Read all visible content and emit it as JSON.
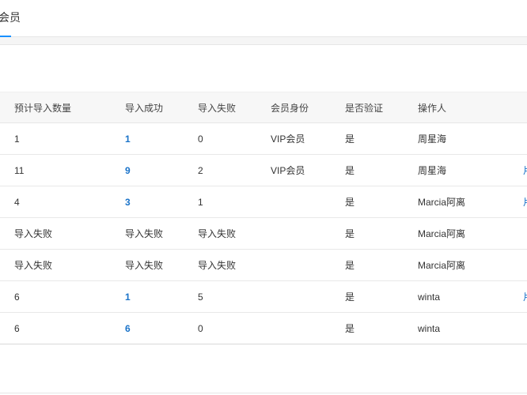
{
  "tab": {
    "label": "会员"
  },
  "table": {
    "headers": [
      "预计导入数量",
      "导入成功",
      "导入失败",
      "会员身份",
      "是否验证",
      "操作人"
    ],
    "rows": [
      {
        "expected": "1",
        "success": "1",
        "fail": "0",
        "identity": "VIP会员",
        "verified": "是",
        "operator": "周星海",
        "action": ""
      },
      {
        "expected": "11",
        "success": "9",
        "fail": "2",
        "identity": "VIP会员",
        "verified": "是",
        "operator": "周星海",
        "action": "片"
      },
      {
        "expected": "4",
        "success": "3",
        "fail": "1",
        "identity": "",
        "verified": "是",
        "operator": "Marcia阿离",
        "action": "片"
      },
      {
        "expected": "导入失败",
        "success": "导入失败",
        "fail": "导入失败",
        "identity": "",
        "verified": "是",
        "operator": "Marcia阿离",
        "action": ""
      },
      {
        "expected": "导入失败",
        "success": "导入失败",
        "fail": "导入失败",
        "identity": "",
        "verified": "是",
        "operator": "Marcia阿离",
        "action": ""
      },
      {
        "expected": "6",
        "success": "1",
        "fail": "5",
        "identity": "",
        "verified": "是",
        "operator": "winta",
        "action": "片"
      },
      {
        "expected": "6",
        "success": "6",
        "fail": "0",
        "identity": "",
        "verified": "是",
        "operator": "winta",
        "action": ""
      }
    ]
  },
  "colors": {
    "accent": "#1890ff",
    "link": "#1a73c9"
  }
}
